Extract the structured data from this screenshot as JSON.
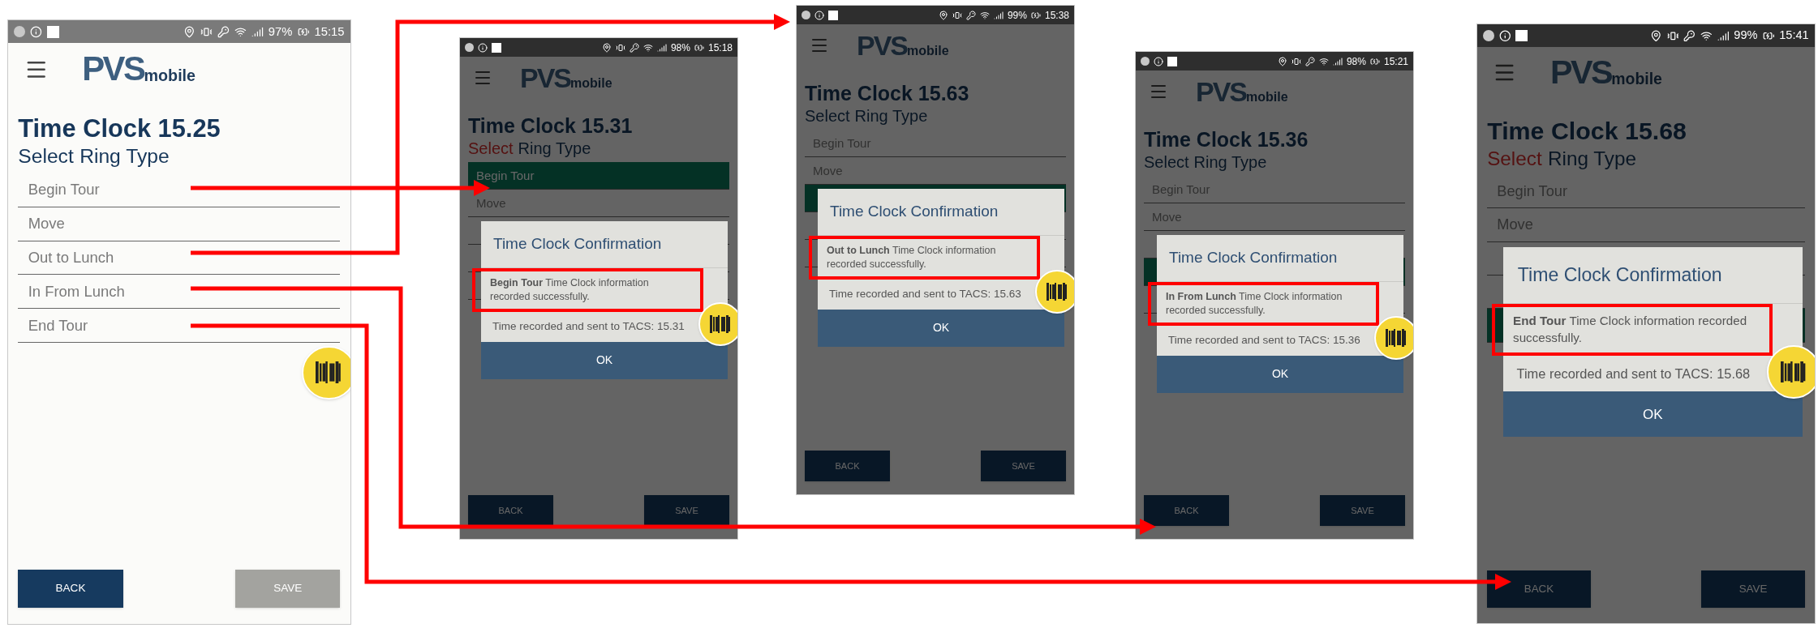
{
  "screens": [
    {
      "status_bar": {
        "battery": "97%",
        "time": "15:15"
      },
      "logo": {
        "main": "PVS",
        "sub": "mobile"
      },
      "title": "Time Clock 15.25",
      "subtitle": [
        {
          "text": "Select",
          "marked": false
        },
        {
          "text": "Ring Type",
          "marked": false
        }
      ],
      "ring_types": [
        {
          "label": "Begin Tour",
          "selected": false
        },
        {
          "label": "Move",
          "selected": false
        },
        {
          "label": "Out to Lunch",
          "selected": false
        },
        {
          "label": "In From Lunch",
          "selected": false
        },
        {
          "label": "End Tour",
          "selected": false
        }
      ],
      "buttons": [
        {
          "label": "BACK",
          "disabled": false
        },
        {
          "label": "SAVE",
          "disabled": true
        }
      ]
    },
    {
      "status_bar": {
        "battery": "98%",
        "time": "15:18"
      },
      "logo": {
        "main": "PVS",
        "sub": "mobile"
      },
      "title": "Time Clock 15.31",
      "subtitle": [
        {
          "text": "Select",
          "marked": true
        },
        {
          "text": "Ring Type",
          "marked": false
        }
      ],
      "ring_types": [
        {
          "label": "Begin Tour",
          "selected": true
        },
        {
          "label": "Move",
          "selected": false
        },
        {
          "selected": false
        },
        {
          "selected": false
        },
        {
          "selected": false
        }
      ],
      "dialog": {
        "title": "Time Clock Confirmation",
        "message": "**Begin Tour** Time Clock information recorded successfully.",
        "message_marked": true,
        "detail": "Time recorded and sent to TACS: 15.31",
        "button": "OK"
      },
      "buttons": [
        {
          "label": "BACK",
          "disabled": false
        },
        {
          "label": "SAVE",
          "disabled": false
        }
      ]
    },
    {
      "status_bar": {
        "battery": "99%",
        "time": "15:38"
      },
      "logo": {
        "main": "PVS",
        "sub": "mobile"
      },
      "title": "Time Clock 15.63",
      "subtitle": [
        {
          "text": "Select",
          "marked": false
        },
        {
          "text": "Ring Type",
          "marked": false
        }
      ],
      "ring_types": [
        {
          "label": "Begin Tour",
          "selected": false
        },
        {
          "label": "Move",
          "selected": false
        },
        {
          "selected": true
        },
        {
          "selected": false
        },
        {
          "selected": false
        }
      ],
      "dialog": {
        "title": "Time Clock Confirmation",
        "message": "**Out to Lunch** Time Clock information recorded successfully.",
        "message_marked": true,
        "detail": "Time recorded and sent to TACS: 15.63",
        "button": "OK"
      },
      "buttons": [
        {
          "label": "BACK",
          "disabled": false
        },
        {
          "label": "SAVE",
          "disabled": false
        }
      ]
    },
    {
      "status_bar": {
        "battery": "98%",
        "time": "15:21"
      },
      "logo": {
        "main": "PVS",
        "sub": "mobile"
      },
      "title": "Time Clock 15.36",
      "subtitle": [
        {
          "text": "Select",
          "marked": false
        },
        {
          "text": "Ring Type",
          "marked": false
        }
      ],
      "ring_types": [
        {
          "label": "Begin Tour",
          "selected": false
        },
        {
          "label": "Move",
          "selected": false
        },
        {
          "selected": false
        },
        {
          "selected": true
        },
        {
          "selected": false
        }
      ],
      "dialog": {
        "title": "Time Clock Confirmation",
        "message": "**In From Lunch** Time Clock information recorded successfully.",
        "message_marked": true,
        "detail": "Time recorded and sent to TACS: 15.36",
        "button": "OK"
      },
      "buttons": [
        {
          "label": "BACK",
          "disabled": false
        },
        {
          "label": "SAVE",
          "disabled": false
        }
      ]
    },
    {
      "status_bar": {
        "battery": "99%",
        "time": "15:41"
      },
      "logo": {
        "main": "PVS",
        "sub": "mobile"
      },
      "title": "Time Clock 15.68",
      "subtitle": [
        {
          "text": "Select",
          "marked": true
        },
        {
          "text": "Ring Type",
          "marked": false
        }
      ],
      "ring_types": [
        {
          "label": "Begin Tour",
          "selected": false
        },
        {
          "label": "Move",
          "selected": false
        },
        {
          "selected": false
        },
        {
          "selected": false
        },
        {
          "selected": true
        }
      ],
      "dialog": {
        "title": "Time Clock Confirmation",
        "message": "**End Tour** Time Clock information recorded successfully.",
        "message_marked": true,
        "detail": "Time recorded and sent to TACS: 15.68",
        "button": "OK"
      },
      "buttons": [
        {
          "label": "BACK",
          "disabled": false
        },
        {
          "label": "SAVE",
          "disabled": false
        }
      ]
    }
  ]
}
